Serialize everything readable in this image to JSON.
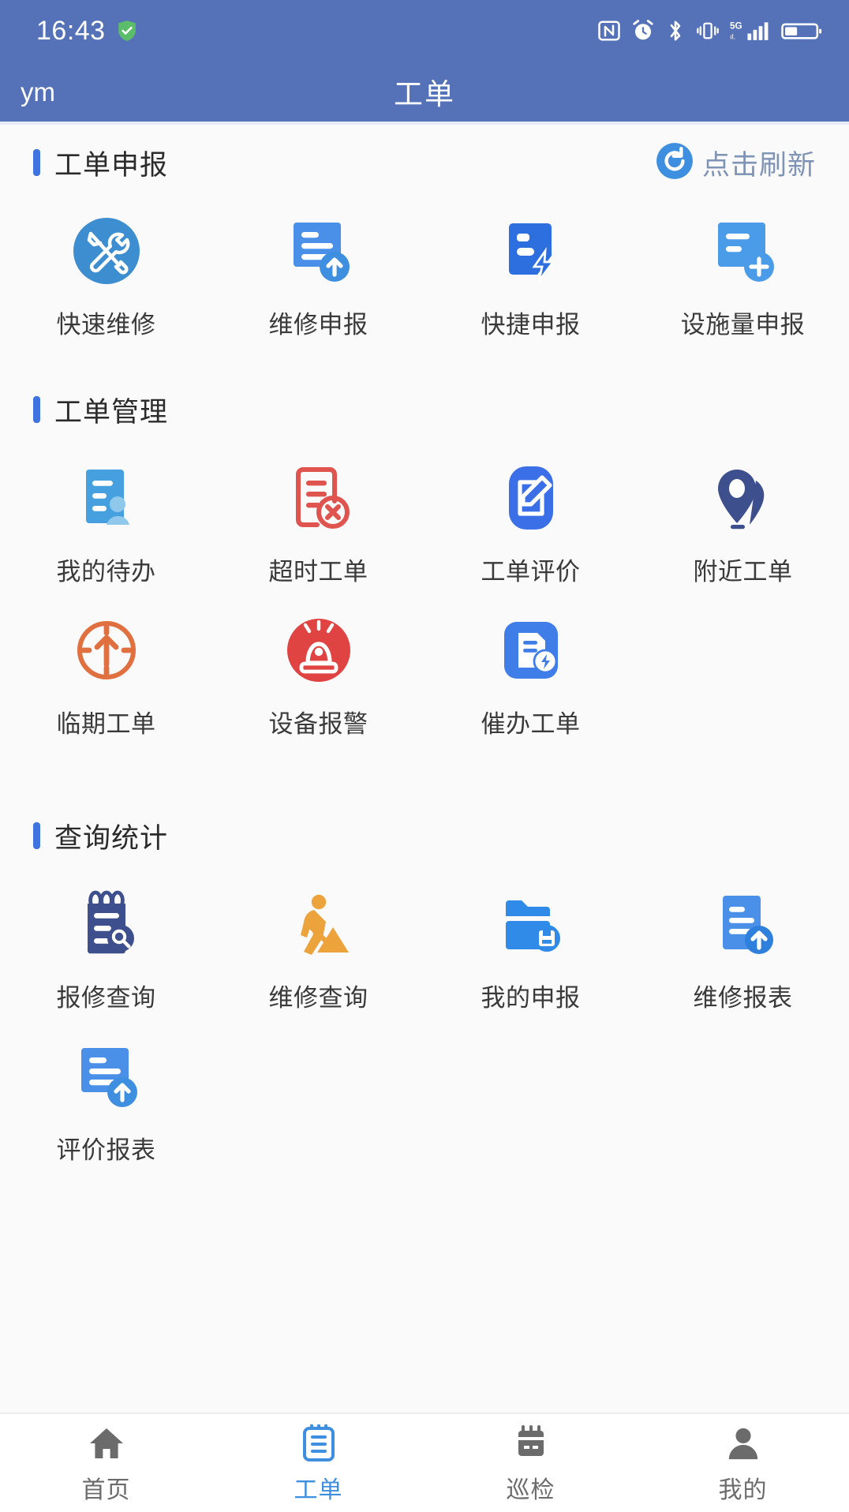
{
  "statusbar": {
    "time": "16:43",
    "icons": [
      "shield-icon",
      "nfc-icon",
      "alarm-icon",
      "bluetooth-icon",
      "vibrate-icon",
      "signal-5g-icon",
      "battery-icon"
    ],
    "network": "5G",
    "background_color": "#5572b8"
  },
  "appbar": {
    "left_label": "ym",
    "title": "工单",
    "background_color": "#5572b8",
    "text_color": "#ffffff"
  },
  "sections": [
    {
      "title": "工单申报",
      "accent_color": "#3f74e0",
      "action": {
        "label": "点击刷新",
        "icon": "refresh-icon",
        "color": "#7f93b5"
      },
      "items": [
        {
          "label": "快速维修",
          "icon": "wrench-screwdriver-icon",
          "color": "#3d8ed0"
        },
        {
          "label": "维修申报",
          "icon": "document-upload-icon",
          "color": "#4a90e8"
        },
        {
          "label": "快捷申报",
          "icon": "document-lightning-icon",
          "color": "#2e6fe0"
        },
        {
          "label": "设施量申报",
          "icon": "document-plus-icon",
          "color": "#4a9be8"
        }
      ]
    },
    {
      "title": "工单管理",
      "accent_color": "#3f74e0",
      "items": [
        {
          "label": "我的待办",
          "icon": "document-person-icon",
          "color": "#46a0e0"
        },
        {
          "label": "超时工单",
          "icon": "document-cancel-icon",
          "color": "#e0544f"
        },
        {
          "label": "工单评价",
          "icon": "document-pencil-icon",
          "color": "#3b6fe8"
        },
        {
          "label": "附近工单",
          "icon": "location-pins-icon",
          "color": "#3d4f8c"
        },
        {
          "label": "临期工单",
          "icon": "target-arrow-icon",
          "color": "#e0703f"
        },
        {
          "label": "设备报警",
          "icon": "siren-alarm-icon",
          "color": "#e04442"
        },
        {
          "label": "催办工单",
          "icon": "document-bolt-icon",
          "color": "#3f7ee8"
        }
      ]
    },
    {
      "title": "查询统计",
      "accent_color": "#3f74e0",
      "items": [
        {
          "label": "报修查询",
          "icon": "notepad-search-icon",
          "color": "#3d4f8c"
        },
        {
          "label": "维修查询",
          "icon": "worker-digging-icon",
          "color": "#eda33c"
        },
        {
          "label": "我的申报",
          "icon": "folder-save-icon",
          "color": "#2f8ae8"
        },
        {
          "label": "维修报表",
          "icon": "document-upload-icon",
          "color": "#4a90e8"
        },
        {
          "label": "评价报表",
          "icon": "document-upload-icon",
          "color": "#4a90e8"
        }
      ]
    }
  ],
  "tabbar": {
    "active_color": "#3f8fe0",
    "inactive_color": "#6b6b6b",
    "tabs": [
      {
        "label": "首页",
        "icon": "home-icon",
        "active": false
      },
      {
        "label": "工单",
        "icon": "clipboard-icon",
        "active": true
      },
      {
        "label": "巡检",
        "icon": "inspect-device-icon",
        "active": false
      },
      {
        "label": "我的",
        "icon": "person-icon",
        "active": false
      }
    ]
  }
}
